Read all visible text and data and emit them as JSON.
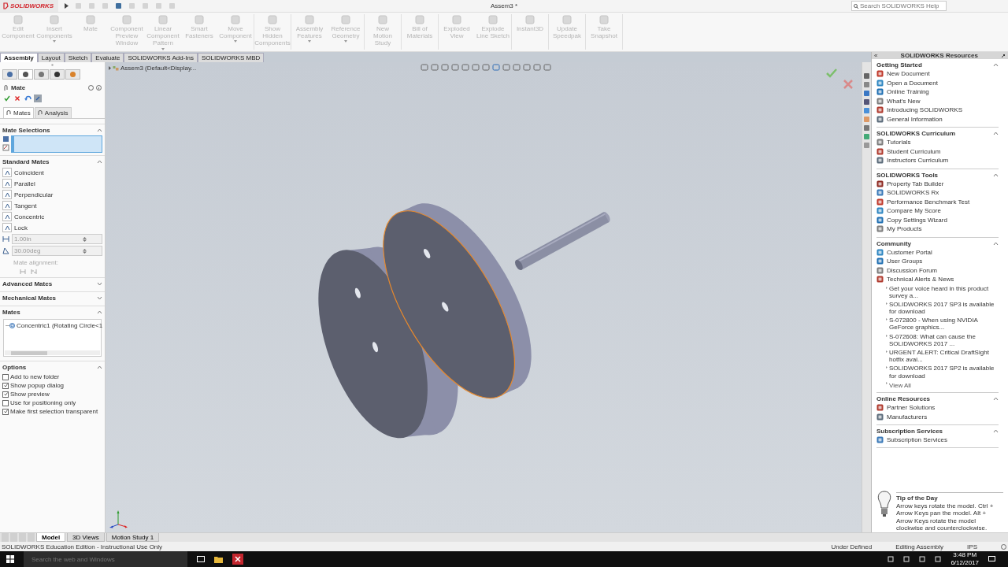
{
  "window": {
    "title": "Assem3 *",
    "help_search": {
      "placeholder": "Search SOLIDWORKS Help"
    }
  },
  "logo": {
    "text": "SOLIDWORKS"
  },
  "command_groups": [
    {
      "commands": [
        {
          "label": "Edit Component",
          "disabled": true,
          "dropdown": false
        },
        {
          "label": "Insert Components",
          "disabled": true,
          "dropdown": true
        },
        {
          "label": "Mate",
          "disabled": true,
          "dropdown": false
        },
        {
          "label": "Component Preview Window",
          "disabled": true,
          "dropdown": false
        },
        {
          "label": "Linear Component Pattern",
          "disabled": true,
          "dropdown": true
        },
        {
          "label": "Smart Fasteners",
          "disabled": true,
          "dropdown": false
        },
        {
          "label": "Move Component",
          "disabled": true,
          "dropdown": true
        }
      ]
    },
    {
      "commands": [
        {
          "label": "Show Hidden Components",
          "disabled": true,
          "dropdown": false
        }
      ]
    },
    {
      "commands": [
        {
          "label": "Assembly Features",
          "disabled": true,
          "dropdown": true
        },
        {
          "label": "Reference Geometry",
          "disabled": true,
          "dropdown": true
        }
      ]
    },
    {
      "commands": [
        {
          "label": "New Motion Study",
          "disabled": true,
          "dropdown": false
        }
      ]
    },
    {
      "commands": [
        {
          "label": "Bill of Materials",
          "disabled": true,
          "dropdown": false
        }
      ]
    },
    {
      "commands": [
        {
          "label": "Exploded View",
          "disabled": true,
          "dropdown": false
        },
        {
          "label": "Explode Line Sketch",
          "disabled": true,
          "dropdown": false
        }
      ]
    },
    {
      "commands": [
        {
          "label": "Instant3D",
          "disabled": true,
          "dropdown": false
        }
      ]
    },
    {
      "commands": [
        {
          "label": "Update Speedpak",
          "disabled": true,
          "dropdown": false
        }
      ]
    },
    {
      "commands": [
        {
          "label": "Take Snapshot",
          "disabled": true,
          "dropdown": false
        }
      ]
    }
  ],
  "ribbon_tabs": [
    {
      "label": "Assembly",
      "selected": true
    },
    {
      "label": "Layout",
      "selected": false
    },
    {
      "label": "Sketch",
      "selected": false
    },
    {
      "label": "Evaluate",
      "selected": false
    },
    {
      "label": "SOLIDWORKS Add-Ins",
      "selected": false
    },
    {
      "label": "SOLIDWORKS MBD",
      "selected": false
    }
  ],
  "manager_tabs": [
    {
      "selected": false
    },
    {
      "selected": true
    },
    {
      "selected": false
    },
    {
      "selected": false
    },
    {
      "selected": false
    }
  ],
  "property_manager": {
    "title": "Mate",
    "tabs": [
      {
        "label": "Mates",
        "selected": true
      },
      {
        "label": "Analysis",
        "selected": false
      }
    ],
    "mate_selections": {
      "title": "Mate Selections",
      "expanded": true
    },
    "standard_mates": {
      "title": "Standard Mates",
      "expanded": true,
      "items": [
        {
          "label": "Coincident"
        },
        {
          "label": "Parallel"
        },
        {
          "label": "Perpendicular"
        },
        {
          "label": "Tangent"
        },
        {
          "label": "Concentric"
        },
        {
          "label": "Lock"
        }
      ],
      "distance_value": "1.00in",
      "angle_value": "30.00deg",
      "alignment_label": "Mate alignment:"
    },
    "collapsed_sections": [
      {
        "title": "Advanced Mates",
        "expanded": false
      },
      {
        "title": "Mechanical Mates",
        "expanded": false
      }
    ],
    "mates": {
      "title": "Mates",
      "expanded": true,
      "items": [
        {
          "label": "Concentric1 (Rotating Circle<1"
        }
      ]
    },
    "options": {
      "title": "Options",
      "expanded": true,
      "items": [
        {
          "label": "Add to new folder",
          "checked": false
        },
        {
          "label": "Show popup dialog",
          "checked": true
        },
        {
          "label": "Show preview",
          "checked": true
        },
        {
          "label": "Use for positioning only",
          "checked": false
        },
        {
          "label": "Make first selection transparent",
          "checked": true
        }
      ]
    }
  },
  "feature_tree": {
    "root": "Assem3  (Default<Display..."
  },
  "model_parts": [
    {
      "kind": "disk",
      "selected": false
    },
    {
      "kind": "disk",
      "selected": true
    },
    {
      "kind": "pin",
      "selected": false
    }
  ],
  "task_pane": {
    "title": "SOLIDWORKS Resources",
    "collapse_glyph": "«",
    "sections": [
      {
        "title": "Getting Started",
        "expanded": true,
        "items": [
          "New Document",
          "Open a Document",
          "Online Training",
          "What's New",
          "Introducing SOLIDWORKS",
          "General Information"
        ]
      },
      {
        "title": "SOLIDWORKS Curriculum",
        "expanded": true,
        "items": [
          "Tutorials",
          "Student Curriculum",
          "Instructors Curriculum"
        ]
      },
      {
        "title": "SOLIDWORKS Tools",
        "expanded": true,
        "items": [
          "Property Tab Builder",
          "SOLIDWORKS Rx",
          "Performance Benchmark Test",
          "Compare My Score",
          "Copy Settings Wizard",
          "My Products"
        ]
      },
      {
        "title": "Community",
        "expanded": true,
        "items": [
          "Customer Portal",
          "User Groups",
          "Discussion Forum",
          "Technical Alerts & News"
        ],
        "news": [
          "Get your voice heard in this product survey a...",
          "SOLIDWORKS 2017 SP3 is available for download",
          "S-072800 - When using NVIDIA GeForce graphics...",
          "S-072608: What can cause the SOLIDWORKS 2017 ...",
          "URGENT ALERT: Critical DraftSight hotfix avai...",
          "SOLIDWORKS 2017 SP2 is available for download"
        ],
        "view_all": "View All"
      },
      {
        "title": "Online Resources",
        "expanded": true,
        "items": [
          "Partner Solutions",
          "Manufacturers"
        ]
      },
      {
        "title": "Subscription Services",
        "expanded": true,
        "items": [
          "Subscription Services"
        ]
      }
    ],
    "tip": {
      "title": "Tip of the Day",
      "text": "Arrow keys rotate the model. Ctrl + Arrow Keys pan the model. Alt + Arrow Keys rotate the model clockwise and counterclockwise."
    }
  },
  "model_tabs": [
    {
      "label": "Model",
      "selected": true
    },
    {
      "label": "3D Views",
      "selected": false
    },
    {
      "label": "Motion Study 1",
      "selected": false
    }
  ],
  "status_bar": {
    "edition": "SOLIDWORKS Education Edition - Instructional Use Only",
    "items": [
      "Under Defined",
      "Editing Assembly",
      "IPS"
    ]
  },
  "taskbar": {
    "search": {
      "placeholder": "Search the web and Windows"
    },
    "time": "3:48 PM",
    "date": "6/12/2017"
  }
}
